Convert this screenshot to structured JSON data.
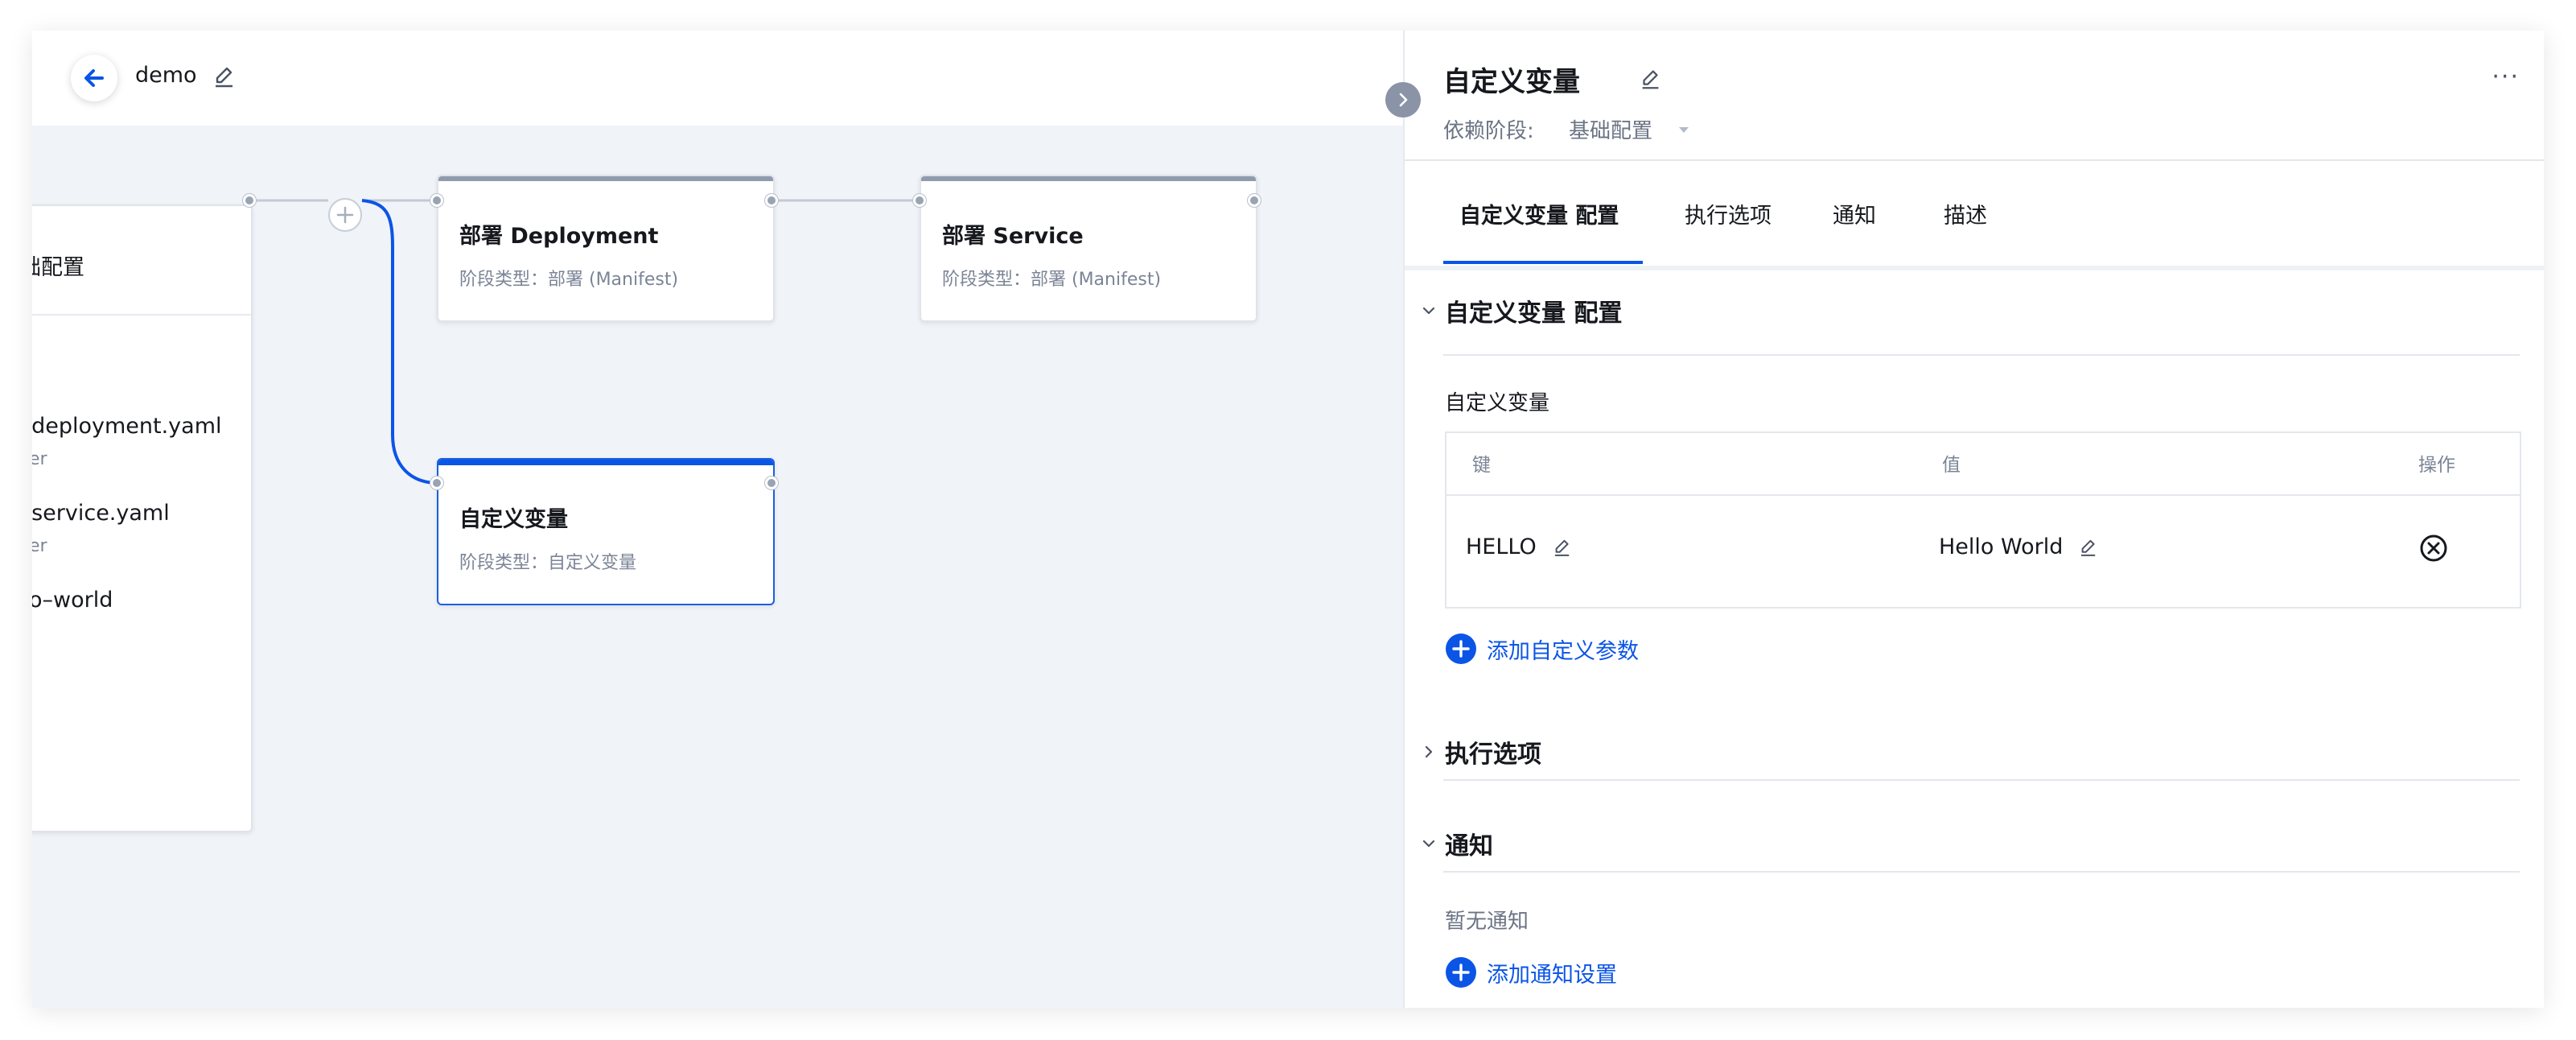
{
  "header": {
    "back_label": "back",
    "pipeline_name": "demo"
  },
  "canvas": {
    "partial_node": {
      "title": "础配置",
      "lines": [
        {
          "text": "/deployment.yaml",
          "sub": "er"
        },
        {
          "text": "/service.yaml",
          "sub": "er"
        },
        {
          "text": "o–world",
          "sub": ""
        }
      ]
    },
    "nodes": [
      {
        "id": "deploy",
        "title": "部署 Deployment",
        "subtitle": "阶段类型：部署 (Manifest)"
      },
      {
        "id": "service",
        "title": "部署 Service",
        "subtitle": "阶段类型：部署 (Manifest)"
      },
      {
        "id": "custom",
        "title": "自定义变量",
        "subtitle": "阶段类型：自定义变量",
        "selected": true
      }
    ],
    "plus_symbol": "+"
  },
  "panel": {
    "title": "自定义变量",
    "more_symbol": "···",
    "dependency_label": "依赖阶段:",
    "dependency_value": "基础配置",
    "tabs": [
      {
        "label": "自定义变量 配置",
        "active": true
      },
      {
        "label": "执行选项",
        "active": false
      },
      {
        "label": "通知",
        "active": false
      },
      {
        "label": "描述",
        "active": false
      }
    ],
    "sections": {
      "config": {
        "title": "自定义变量 配置",
        "expanded": true
      },
      "exec": {
        "title": "执行选项",
        "expanded": false
      },
      "notify": {
        "title": "通知",
        "expanded": true
      }
    },
    "variables": {
      "label": "自定义变量",
      "columns": [
        "键",
        "值",
        "操作"
      ],
      "rows": [
        {
          "key": "HELLO",
          "value": "Hello World"
        }
      ],
      "add_label": "添加自定义参数"
    },
    "notify": {
      "empty_text": "暂无通知",
      "add_label": "添加通知设置"
    }
  },
  "colors": {
    "accent": "#0b55e6",
    "canvas_bg": "#f0f3f8",
    "node_border": "#dfe3ea",
    "muted_text": "#7b8496"
  }
}
